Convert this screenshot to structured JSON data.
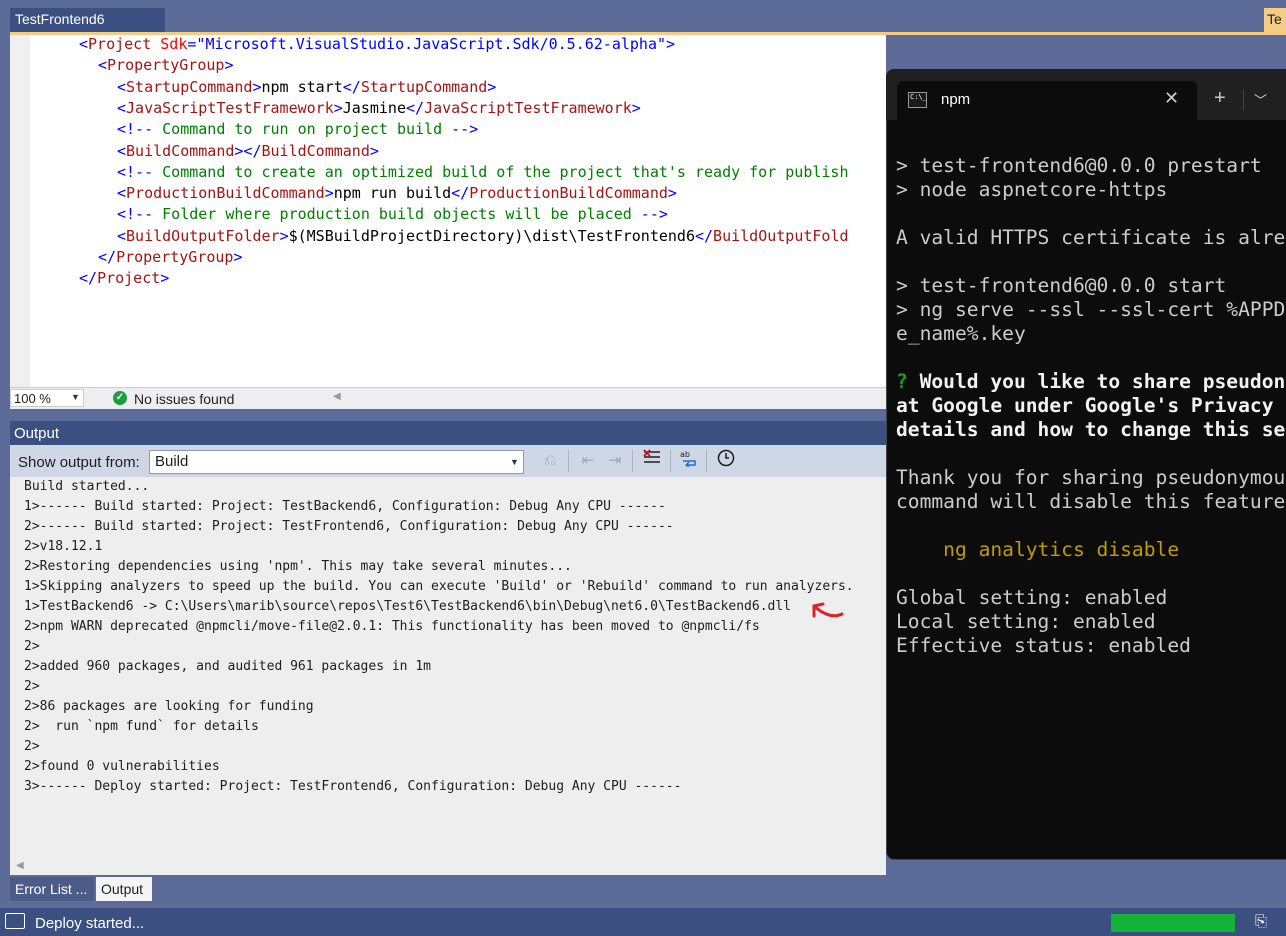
{
  "editor": {
    "tab_title": "TestFrontend6",
    "right_tab_title": "Te",
    "lines": [
      {
        "indent": 0,
        "parts": [
          [
            "br",
            "<"
          ],
          [
            "tag",
            "Project"
          ],
          [
            "txt",
            " "
          ],
          [
            "attr",
            "Sdk"
          ],
          [
            "br",
            "=\""
          ],
          [
            "val",
            "Microsoft.VisualStudio.JavaScript.Sdk/0.5.62-alpha"
          ],
          [
            "br",
            "\">"
          ]
        ]
      },
      {
        "indent": 1,
        "parts": [
          [
            "br",
            "<"
          ],
          [
            "tag",
            "PropertyGroup"
          ],
          [
            "br",
            ">"
          ]
        ]
      },
      {
        "indent": 2,
        "parts": [
          [
            "br",
            "<"
          ],
          [
            "tag",
            "StartupCommand"
          ],
          [
            "br",
            ">"
          ],
          [
            "txt",
            "npm start"
          ],
          [
            "br",
            "</"
          ],
          [
            "tag",
            "StartupCommand"
          ],
          [
            "br",
            ">"
          ]
        ]
      },
      {
        "indent": 2,
        "parts": [
          [
            "br",
            "<"
          ],
          [
            "tag",
            "JavaScriptTestFramework"
          ],
          [
            "br",
            ">"
          ],
          [
            "txt",
            "Jasmine"
          ],
          [
            "br",
            "</"
          ],
          [
            "tag",
            "JavaScriptTestFramework"
          ],
          [
            "br",
            ">"
          ]
        ]
      },
      {
        "indent": 2,
        "parts": [
          [
            "br",
            "<!--"
          ],
          [
            "cm",
            " Command to run on project build "
          ],
          [
            "br",
            "-->"
          ]
        ]
      },
      {
        "indent": 2,
        "parts": [
          [
            "br",
            "<"
          ],
          [
            "tag",
            "BuildCommand"
          ],
          [
            "br",
            "></"
          ],
          [
            "tag",
            "BuildCommand"
          ],
          [
            "br",
            ">"
          ]
        ]
      },
      {
        "indent": 2,
        "parts": [
          [
            "br",
            "<!--"
          ],
          [
            "cm",
            " Command to create an optimized build of the project that's ready for publish"
          ]
        ]
      },
      {
        "indent": 2,
        "parts": [
          [
            "br",
            "<"
          ],
          [
            "tag",
            "ProductionBuildCommand"
          ],
          [
            "br",
            ">"
          ],
          [
            "txt",
            "npm run build"
          ],
          [
            "br",
            "</"
          ],
          [
            "tag",
            "ProductionBuildCommand"
          ],
          [
            "br",
            ">"
          ]
        ]
      },
      {
        "indent": 2,
        "parts": [
          [
            "br",
            "<!--"
          ],
          [
            "cm",
            " Folder where production build objects will be placed "
          ],
          [
            "br",
            "-->"
          ]
        ]
      },
      {
        "indent": 2,
        "parts": [
          [
            "br",
            "<"
          ],
          [
            "tag",
            "BuildOutputFolder"
          ],
          [
            "br",
            ">"
          ],
          [
            "txt",
            "$(MSBuildProjectDirectory)\\dist\\TestFrontend6"
          ],
          [
            "br",
            "</"
          ],
          [
            "tag",
            "BuildOutputFold"
          ]
        ]
      },
      {
        "indent": 1,
        "parts": [
          [
            "br",
            "</"
          ],
          [
            "tag",
            "PropertyGroup"
          ],
          [
            "br",
            ">"
          ]
        ]
      },
      {
        "indent": 0,
        "parts": [
          [
            "br",
            "</"
          ],
          [
            "tag",
            "Project"
          ],
          [
            "br",
            ">"
          ]
        ]
      }
    ],
    "zoom": "100 %",
    "issues": "No issues found"
  },
  "output": {
    "title": "Output",
    "show_from_label": "Show output from:",
    "source": "Build",
    "lines": [
      "Build started...",
      "1>------ Build started: Project: TestBackend6, Configuration: Debug Any CPU ------",
      "2>------ Build started: Project: TestFrontend6, Configuration: Debug Any CPU ------",
      "2>v18.12.1",
      "2>Restoring dependencies using 'npm'. This may take several minutes...",
      "1>Skipping analyzers to speed up the build. You can execute 'Build' or 'Rebuild' command to run analyzers.",
      "1>TestBackend6 -> C:\\Users\\marib\\source\\repos\\Test6\\TestBackend6\\bin\\Debug\\net6.0\\TestBackend6.dll",
      "2>npm WARN deprecated @npmcli/move-file@2.0.1: This functionality has been moved to @npmcli/fs",
      "2>",
      "2>added 960 packages, and audited 961 packages in 1m",
      "2>",
      "2>86 packages are looking for funding",
      "2>  run `npm fund` for details",
      "2>",
      "2>found 0 vulnerabilities",
      "3>------ Deploy started: Project: TestFrontend6, Configuration: Debug Any CPU ------"
    ]
  },
  "bottom_tabs": {
    "error_list": "Error List ...",
    "output": "Output"
  },
  "status": {
    "text": "Deploy started...",
    "progress": 1.0
  },
  "terminal": {
    "tab_label": "npm",
    "icon_glyph": "C:\\_",
    "lines": [
      {
        "segs": [
          [
            "n",
            "> test-frontend6@0.0.0 prestart"
          ]
        ]
      },
      {
        "segs": [
          [
            "n",
            "> node aspnetcore-https"
          ]
        ]
      },
      {
        "segs": [
          [
            "n",
            ""
          ]
        ]
      },
      {
        "segs": [
          [
            "n",
            "A valid HTTPS certificate is alre"
          ]
        ]
      },
      {
        "segs": [
          [
            "n",
            ""
          ]
        ]
      },
      {
        "segs": [
          [
            "n",
            "> test-frontend6@0.0.0 start"
          ]
        ]
      },
      {
        "segs": [
          [
            "n",
            "> ng serve --ssl --ssl-cert %APPD"
          ]
        ]
      },
      {
        "segs": [
          [
            "n",
            "e_name%.key"
          ]
        ]
      },
      {
        "segs": [
          [
            "n",
            ""
          ]
        ]
      },
      {
        "segs": [
          [
            "g",
            "? "
          ],
          [
            "b",
            "Would you like to share pseudon"
          ]
        ]
      },
      {
        "segs": [
          [
            "b",
            "at Google under Google's Privacy "
          ]
        ]
      },
      {
        "segs": [
          [
            "b",
            "details and how to change this se"
          ]
        ]
      },
      {
        "segs": [
          [
            "n",
            ""
          ]
        ]
      },
      {
        "segs": [
          [
            "n",
            "Thank you for sharing pseudonymou"
          ]
        ]
      },
      {
        "segs": [
          [
            "n",
            "command will disable this feature"
          ]
        ]
      },
      {
        "segs": [
          [
            "n",
            ""
          ]
        ]
      },
      {
        "segs": [
          [
            "y",
            "    ng analytics disable"
          ]
        ]
      },
      {
        "segs": [
          [
            "n",
            ""
          ]
        ]
      },
      {
        "segs": [
          [
            "n",
            "Global setting: enabled"
          ]
        ]
      },
      {
        "segs": [
          [
            "n",
            "Local setting: enabled"
          ]
        ]
      },
      {
        "segs": [
          [
            "n",
            "Effective status: enabled"
          ]
        ]
      }
    ]
  }
}
